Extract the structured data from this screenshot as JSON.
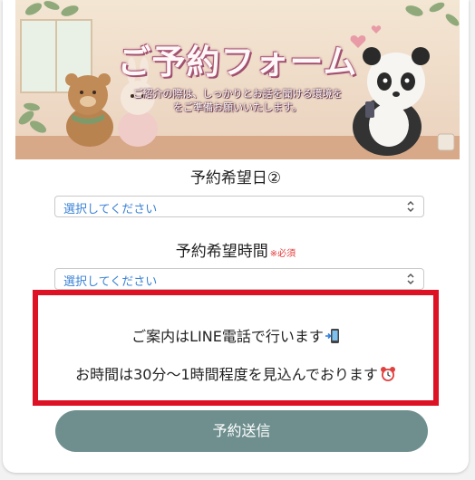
{
  "banner": {
    "title": "ご予約フォーム",
    "subtitle_line1": "ご紹介の際は、しっかりとお話を聞ける環境を",
    "subtitle_line2": "をご準備お願いいたします。"
  },
  "form": {
    "date_label": "予約希望日②",
    "date_select_value": "選択してください",
    "time_label": "予約希望時間",
    "time_required": "※必須",
    "time_select_value": "選択してください"
  },
  "notice": {
    "line1": "ご案内はLINE電話で行います",
    "line2": "お時間は30分〜1時間程度を見込んでおります"
  },
  "submit_label": "予約送信",
  "icons": {
    "phone": "mobile-phone-incoming-icon",
    "clock": "alarm-clock-icon",
    "chevron": "select-chevron-icon"
  },
  "colors": {
    "notice_border": "#dd1224",
    "submit_bg": "#6f8f8f",
    "select_text": "#3b83d6",
    "required": "#e23b3b"
  }
}
